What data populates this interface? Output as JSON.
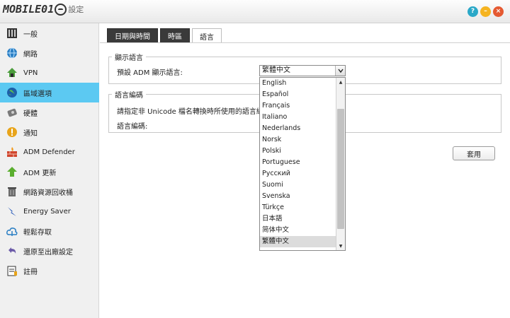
{
  "title_bar": {
    "logo_text": "MOBILE01",
    "logo_sub": "設定",
    "help_label": "?",
    "minimize_label": "–",
    "close_label": "×"
  },
  "sidebar": {
    "items": [
      {
        "label": "一般",
        "icon": "general-icon"
      },
      {
        "label": "網路",
        "icon": "globe-icon"
      },
      {
        "label": "VPN",
        "icon": "vpn-icon"
      },
      {
        "label": "區域選項",
        "icon": "region-globe-icon"
      },
      {
        "label": "硬體",
        "icon": "hardware-icon"
      },
      {
        "label": "通知",
        "icon": "notification-icon"
      },
      {
        "label": "ADM Defender",
        "icon": "firewall-icon"
      },
      {
        "label": "ADM 更新",
        "icon": "update-arrow-icon"
      },
      {
        "label": "網路資源回收桶",
        "icon": "recycle-bin-icon"
      },
      {
        "label": "Energy Saver",
        "icon": "energy-icon"
      },
      {
        "label": "輕鬆存取",
        "icon": "cloud-access-icon"
      },
      {
        "label": "還原至出廠設定",
        "icon": "restore-icon"
      },
      {
        "label": "註冊",
        "icon": "register-icon"
      }
    ],
    "active_index": 3,
    "active_color": "#5cc9f2"
  },
  "tabs": [
    {
      "label": "日期與時間"
    },
    {
      "label": "時區"
    },
    {
      "label": "語言"
    }
  ],
  "display_language": {
    "legend": "顯示語言",
    "label": "預設 ADM 顯示語言:",
    "selected": "繁體中文",
    "options": [
      "English",
      "Español",
      "Français",
      "Italiano",
      "Nederlands",
      "Norsk",
      "Polski",
      "Portuguese",
      "Русский",
      "Suomi",
      "Svenska",
      "Türkçe",
      "日本語",
      "简体中文",
      "繁體中文"
    ]
  },
  "language_encoding": {
    "legend": "語言編碼",
    "description": "請指定非 Unicode 檔名轉換時所使用的語言編",
    "label": "語言編碼:"
  },
  "apply_label": "套用"
}
